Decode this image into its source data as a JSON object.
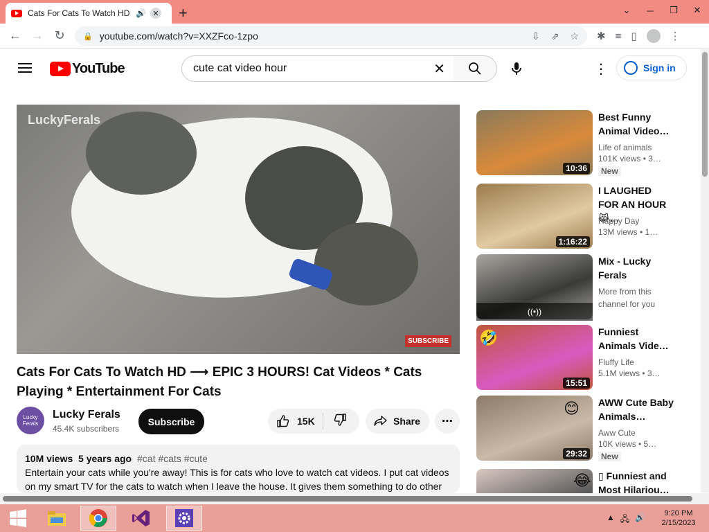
{
  "browser": {
    "tab_title": "Cats For Cats To Watch HD ~",
    "url": "youtube.com/watch?v=XXZFco-1zpo"
  },
  "youtube": {
    "logo_text": "YouTube",
    "search_query": "cute cat video hour",
    "signin_label": "Sign in"
  },
  "player": {
    "watermark": "LuckyFerals",
    "subscribe_badge": "SUBSCRIBE"
  },
  "video": {
    "title": "Cats For Cats To Watch HD ⟶ EPIC 3 HOURS! Cat Videos * Cats Playing * Entertainment For Cats",
    "channel_name": "Lucky Ferals",
    "channel_avatar_text": "Lucky Ferals",
    "subscribers": "45.4K subscribers",
    "subscribe_label": "Subscribe",
    "likes": "15K",
    "share_label": "Share",
    "views": "10M views",
    "age": "5 years ago",
    "tags": "#cat #cats #cute",
    "description": "Entertain your cats while you're away! This is for cats who love to watch cat videos. I put cat videos on my smart TV for the cats to watch when I leave the house. It gives them something to do other"
  },
  "recommendations": [
    {
      "title": "Best Funny Animal Video…",
      "channel": "Life of animals",
      "views": "101K views  • 3…",
      "duration": "10:36",
      "badge": "New",
      "thumb_color": "#8a7a5a",
      "accent": "#d98a3a"
    },
    {
      "title": "I LAUGHED FOR AN HOUR😹…",
      "channel": "Happy Day",
      "views": "13M views  • 1…",
      "duration": "1:16:22",
      "badge": "",
      "thumb_color": "#9c7b4f",
      "accent": "#e0c9a0"
    },
    {
      "title": "Mix - Lucky Ferals",
      "channel": "More from this channel for you",
      "views": "",
      "duration": "",
      "mix_icon": "((•))",
      "badge": "",
      "thumb_color": "#a7a59f",
      "accent": "#3a3a38"
    },
    {
      "title": "Funniest Animals Vide…",
      "channel": "Fluffy Life",
      "views": "5.1M views  • 3…",
      "duration": "15:51",
      "badge": "",
      "thumb_color": "#c0563c",
      "accent": "#d85ac0",
      "emoji": "🤣"
    },
    {
      "title": "AWW Cute Baby Animals…",
      "channel": "Aww Cute",
      "views": "10K views  • 5…",
      "duration": "29:32",
      "badge": "New",
      "thumb_color": "#8d7a68",
      "accent": "#c9b9a8",
      "emoji": "😊"
    },
    {
      "title": "▯ Funniest and Most Hilariou…",
      "channel": "",
      "views": "",
      "duration": "",
      "badge": "",
      "thumb_color": "#d9c8c0",
      "accent": "#5a5a5a",
      "emoji": "😂"
    }
  ],
  "taskbar": {
    "time": "9:20 PM",
    "date": "2/15/2023"
  },
  "colors": {
    "tabstrip": "#f28b82",
    "youtube_red": "#ff0000",
    "link_blue": "#065fd4",
    "taskbar": "#ea9e98"
  }
}
